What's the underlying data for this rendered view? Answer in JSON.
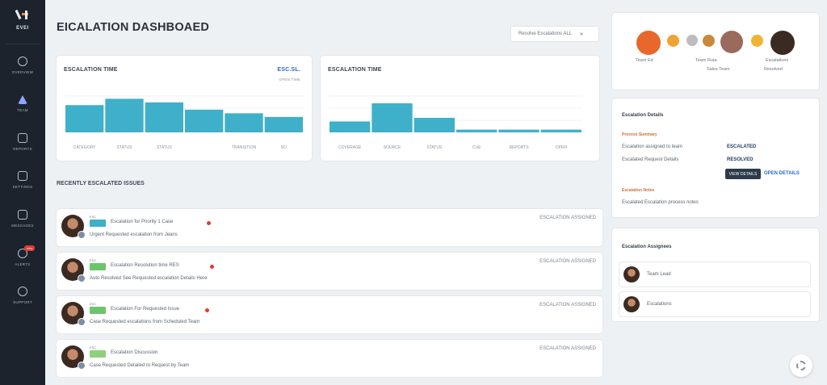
{
  "sidebar": {
    "logo_text": "EVEI",
    "items": [
      {
        "label": "OVERVIEW",
        "icon": "grid-icon"
      },
      {
        "label": "TEAM",
        "icon": "user-icon"
      },
      {
        "label": "REPORTS",
        "icon": "report-icon"
      },
      {
        "label": "SETTINGS",
        "icon": "settings-icon"
      },
      {
        "label": "MESSAGES",
        "icon": "messages-icon"
      },
      {
        "label": "ALERTS",
        "icon": "bell-icon",
        "badge": "new"
      },
      {
        "label": "SUPPORT",
        "icon": "help-icon"
      }
    ]
  },
  "header": {
    "title": "EICALATION DASHBOAED",
    "filter_button": "Resolve Escalations ALL",
    "filter_chevron": "»"
  },
  "cards": {
    "left": {
      "title": "ESCALATION TIME",
      "stat": "ESC.SL.",
      "sub": "OPEN TIME"
    },
    "middle": {
      "title": "ESCALATION TIME"
    }
  },
  "chart_data": [
    {
      "type": "bar",
      "categories": [
        "CATEGORY",
        "STATUS",
        "STATUS",
        "",
        "TRANSITION",
        "SO"
      ],
      "values": [
        30,
        37,
        33,
        25,
        21,
        17
      ],
      "y_tick_labels": [
        "",
        "",
        ""
      ],
      "title": "ESCALATION TIME",
      "legend": "none"
    },
    {
      "type": "bar",
      "categories": [
        "COVERAGE",
        "SOURCE",
        "STATUS",
        "CUE",
        "REPORTS",
        "OPEN"
      ],
      "values": [
        12,
        32,
        16,
        3,
        3,
        3
      ],
      "title": "ESCALATION TIME",
      "legend": "none"
    }
  ],
  "section_title": "RECENTLY ESCALATED ISSUES",
  "escalations": [
    {
      "tiny": "ESC",
      "tag_color": "#3fb0c9",
      "line1": "Escalation for Priority 1 Case",
      "dot": true,
      "line2": "Urgent Requested escalation from Jeans",
      "time": "ESCALATION ASSIGNED"
    },
    {
      "tiny": "ESC",
      "tag_color": "#6cc56d",
      "line1": "Escalation Resolution time RES",
      "dot": true,
      "line2": "Auto Resolved See Requested escalation Details Here",
      "time": "ESCALATION ASSIGNED"
    },
    {
      "tiny": "ESC",
      "tag_color": "#6cc56d",
      "line1": "Escalation For Requested Issue",
      "dot": true,
      "line2": "Case Requested escalations from Scheduled Team",
      "time": "ESCALATION ASSIGNED"
    },
    {
      "tiny": "ESC",
      "tag_color": "#8fd07d",
      "line1": "Escalation Discussion",
      "dot": false,
      "line2": "Case Requested Detailed to Request by Team",
      "time": "ESCALATION ASSIGNED"
    }
  ],
  "team": [
    {
      "label": "Team Ed",
      "color": "#e8672a"
    },
    {
      "label": "",
      "color": "#f0a235"
    },
    {
      "label": "",
      "color": "#bdbdbd"
    },
    {
      "label": "Team Ruta",
      "color": "#c9883c"
    },
    {
      "label": "",
      "color": "#9a6a5c"
    },
    {
      "label": "",
      "color": "#f2b332"
    },
    {
      "label": "Escalations",
      "color": "#3b2a22"
    }
  ],
  "team_sub": [
    "Sales Team",
    "Resolved"
  ],
  "details": {
    "title": "Escalation Details",
    "section1": "Process Summary",
    "row1_key": "Escalation assigned to team",
    "row1_val": "ESCALATED",
    "row2_key": "Escalated Request Details",
    "row2_val": "RESOLVED",
    "action_button": "VIEW DETAILS",
    "action_link": "OPEN DETAILS",
    "section2": "Escalation Notes",
    "note": "Escalated Escalation process notes"
  },
  "assignees": {
    "title": "Escalation Assignees",
    "people": [
      "Team Lead",
      "Escalations"
    ]
  },
  "colors": {
    "bar": "#3fb0c9",
    "accent": "#e53935",
    "sidebar": "#1c232c"
  }
}
